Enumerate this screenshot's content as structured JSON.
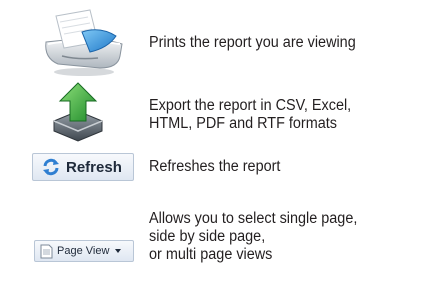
{
  "items": [
    {
      "icon": "printer-icon",
      "description": [
        "Prints the report you are viewing"
      ]
    },
    {
      "icon": "export-icon",
      "description": [
        "Export the report in CSV, Excel,",
        "HTML, PDF and RTF formats"
      ]
    },
    {
      "icon": "refresh-icon",
      "button_label": "Refresh",
      "description": [
        "Refreshes the report"
      ]
    },
    {
      "icon": "page-view-icon",
      "button_label": "Page View",
      "dropdown_icon": "caret-down-icon",
      "description": [
        "Allows you to select single page,",
        "side by side page,",
        "or multi page views"
      ]
    }
  ],
  "colors": {
    "text": "#231f20",
    "accent_blue": "#2f7fd1",
    "accent_green": "#3ea540"
  }
}
